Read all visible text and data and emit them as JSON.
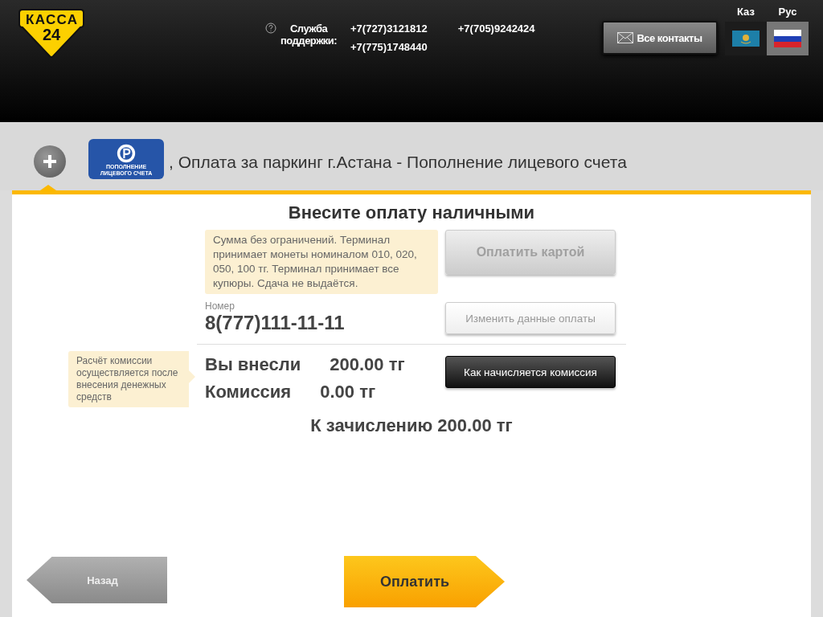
{
  "header": {
    "logo": {
      "line_1": "КАССА",
      "line_2": "24"
    },
    "support": {
      "label": "Служба поддержки:",
      "phones": [
        "+7(727)3121812",
        "+7(775)1748440",
        "+7(705)9242424"
      ]
    },
    "contacts_button": "Все контакты",
    "languages": [
      {
        "label": "Каз",
        "kind": "kz",
        "selected": false
      },
      {
        "label": "Рус",
        "kind": "ru",
        "selected": true
      }
    ]
  },
  "service": {
    "tile_caption": "ПОПОЛНЕНИЕ ЛИЦЕВОГО СЧЕТА",
    "title": ", Оплата за паркинг г.Астана - Пополнение лицевого счета"
  },
  "payment": {
    "title": "Внесите оплату наличными",
    "note": "Сумма без ограничений. Терминал принимает монеты номиналом 010, 020, 050, 100 тг. Терминал принимает все купюры. Сдача не выдаётся.",
    "field": {
      "label": "Номер",
      "value": "8(777)111-11-11"
    },
    "commission_tip": "Расчёт комиссии осуществляется после внесения денежных средств",
    "amounts": [
      {
        "label": "Вы внесли",
        "value": "200.00 тг"
      },
      {
        "label": "Комиссия",
        "value": "0.00 тг"
      }
    ],
    "buttons": [
      {
        "label": "Оплатить картой",
        "kind": "grey"
      },
      {
        "label": "Изменить данные оплаты",
        "kind": "light"
      },
      {
        "label": "Как начисляется комиссия",
        "kind": "dark"
      }
    ],
    "total": "К зачислению 200.00 тг"
  },
  "footer": {
    "back_button": "Назад",
    "pay_button": "Оплатить"
  }
}
